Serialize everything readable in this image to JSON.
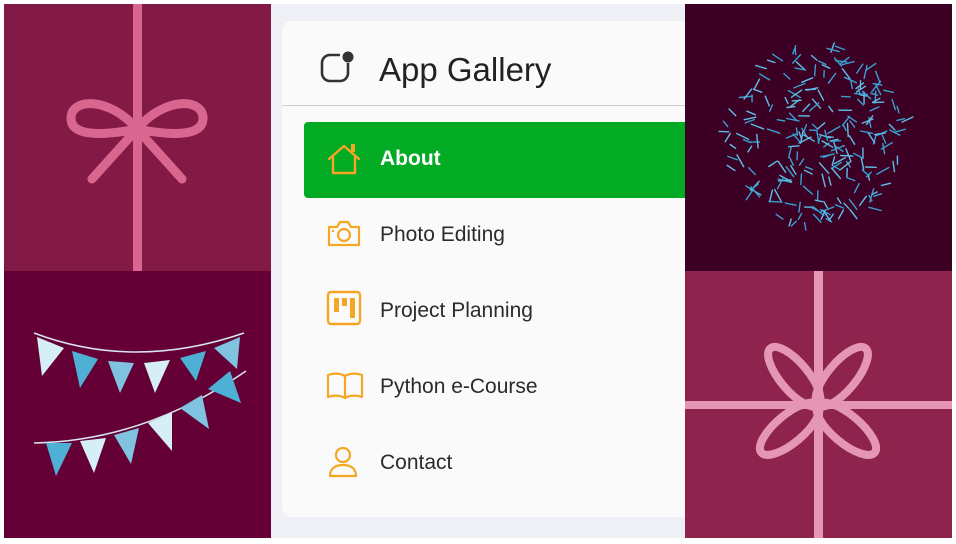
{
  "app": {
    "title": "App Gallery"
  },
  "menu": {
    "items": [
      {
        "label": "About",
        "icon": "home-icon",
        "active": true
      },
      {
        "label": "Photo Editing",
        "icon": "camera-icon",
        "active": false
      },
      {
        "label": "Project Planning",
        "icon": "kanban-board-icon",
        "active": false
      },
      {
        "label": "Python e-Course",
        "icon": "open-book-icon",
        "active": false
      },
      {
        "label": "Contact",
        "icon": "user-icon",
        "active": false
      }
    ]
  },
  "colors": {
    "active_bg": "#03ab24",
    "icon_accent": "#f5a623",
    "tile_gift_ribbon": "#831a45",
    "tile_bunting": "#640035",
    "tile_confetti": "#3c0025",
    "tile_gift_flower": "#8e244d"
  },
  "background_tiles": [
    "gift-bow-tile",
    "bunting-tile",
    "confetti-burst-tile",
    "gift-flower-tile"
  ]
}
